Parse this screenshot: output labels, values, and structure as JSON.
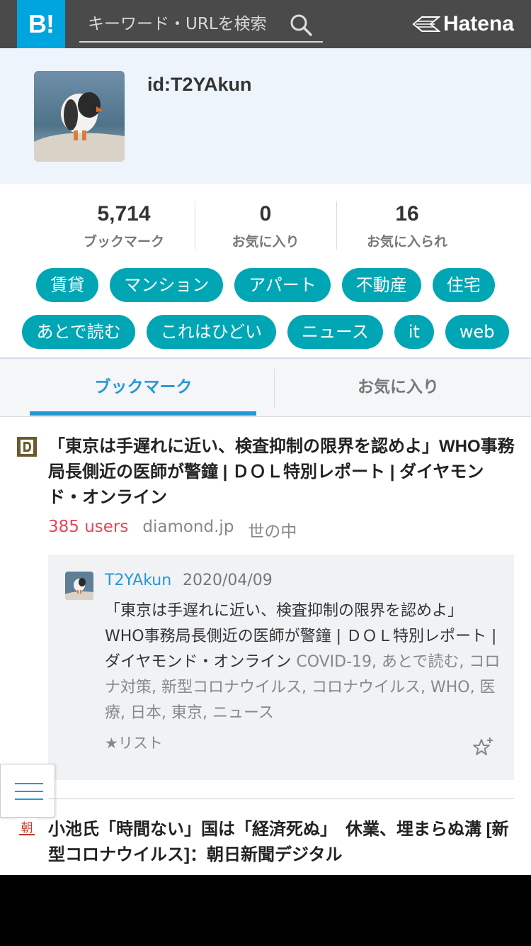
{
  "header": {
    "logo_text": "B!",
    "search_placeholder": "キーワード・URLを検索",
    "brand_name": "Hatena",
    "colors": {
      "header_bg": "#4a4a4a",
      "logo_bg": "#00a4de"
    }
  },
  "profile": {
    "user_id": "id:T2YAkun"
  },
  "stats": [
    {
      "value": "5,714",
      "label": "ブックマーク"
    },
    {
      "value": "0",
      "label": "お気に入り"
    },
    {
      "value": "16",
      "label": "お気に入られ"
    }
  ],
  "tags_row1": [
    "賃貸",
    "マンション",
    "アパート",
    "不動産",
    "住宅"
  ],
  "tags_row2": [
    "あとで読む",
    "これはひどい",
    "ニュース",
    "it",
    "web"
  ],
  "tag_color": "#00a6b4",
  "tabs": [
    {
      "label": "ブックマーク",
      "active": true
    },
    {
      "label": "お気に入り",
      "active": false
    }
  ],
  "entries": [
    {
      "favicon": "diamond-favicon",
      "title": "「東京は手遅れに近い、検査抑制の限界を認めよ」WHO事務局長側近の医師が警鐘 | ＤＯＬ特別レポート | ダイヤモンド・オンライン",
      "users": "385 users",
      "domain": "diamond.jp",
      "category": "世の中",
      "comment": {
        "user": "T2YAkun",
        "date": "2020/04/09",
        "text": "「東京は手遅れに近い、検査抑制の限界を認めよ」WHO事務局長側近の医師が警鐘 | ＤＯＬ特別レポート | ダイヤモンド・オンライン",
        "tags": " COVID-19, あとで読む, コロナ対策, 新型コロナウイルス, コロナウイルス, WHO, 医療, 日本, 東京, ニュース",
        "star_list": "★リスト"
      }
    },
    {
      "favicon": "asahi-favicon",
      "title": "小池氏「時間ない」国は「経済死ぬ」　休業、埋まらぬ溝 [新型コロナウイルス]：朝日新聞デジタル"
    }
  ]
}
